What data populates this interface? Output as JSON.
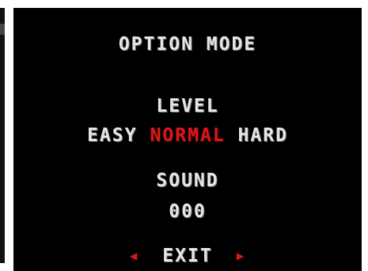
{
  "menu": {
    "title": "OPTION MODE",
    "level_label": "LEVEL",
    "difficulty_options": [
      "EASY",
      "NORMAL",
      "HARD"
    ],
    "selected_difficulty": "NORMAL",
    "sound_label": "SOUND",
    "sound_value": "000",
    "exit_label": "EXIT",
    "left_arrow_icon": "triangle-left-icon",
    "right_arrow_icon": "triangle-right-icon"
  },
  "colors": {
    "background": "#000000",
    "text": "#e6e6e6",
    "highlight": "#d81818"
  }
}
